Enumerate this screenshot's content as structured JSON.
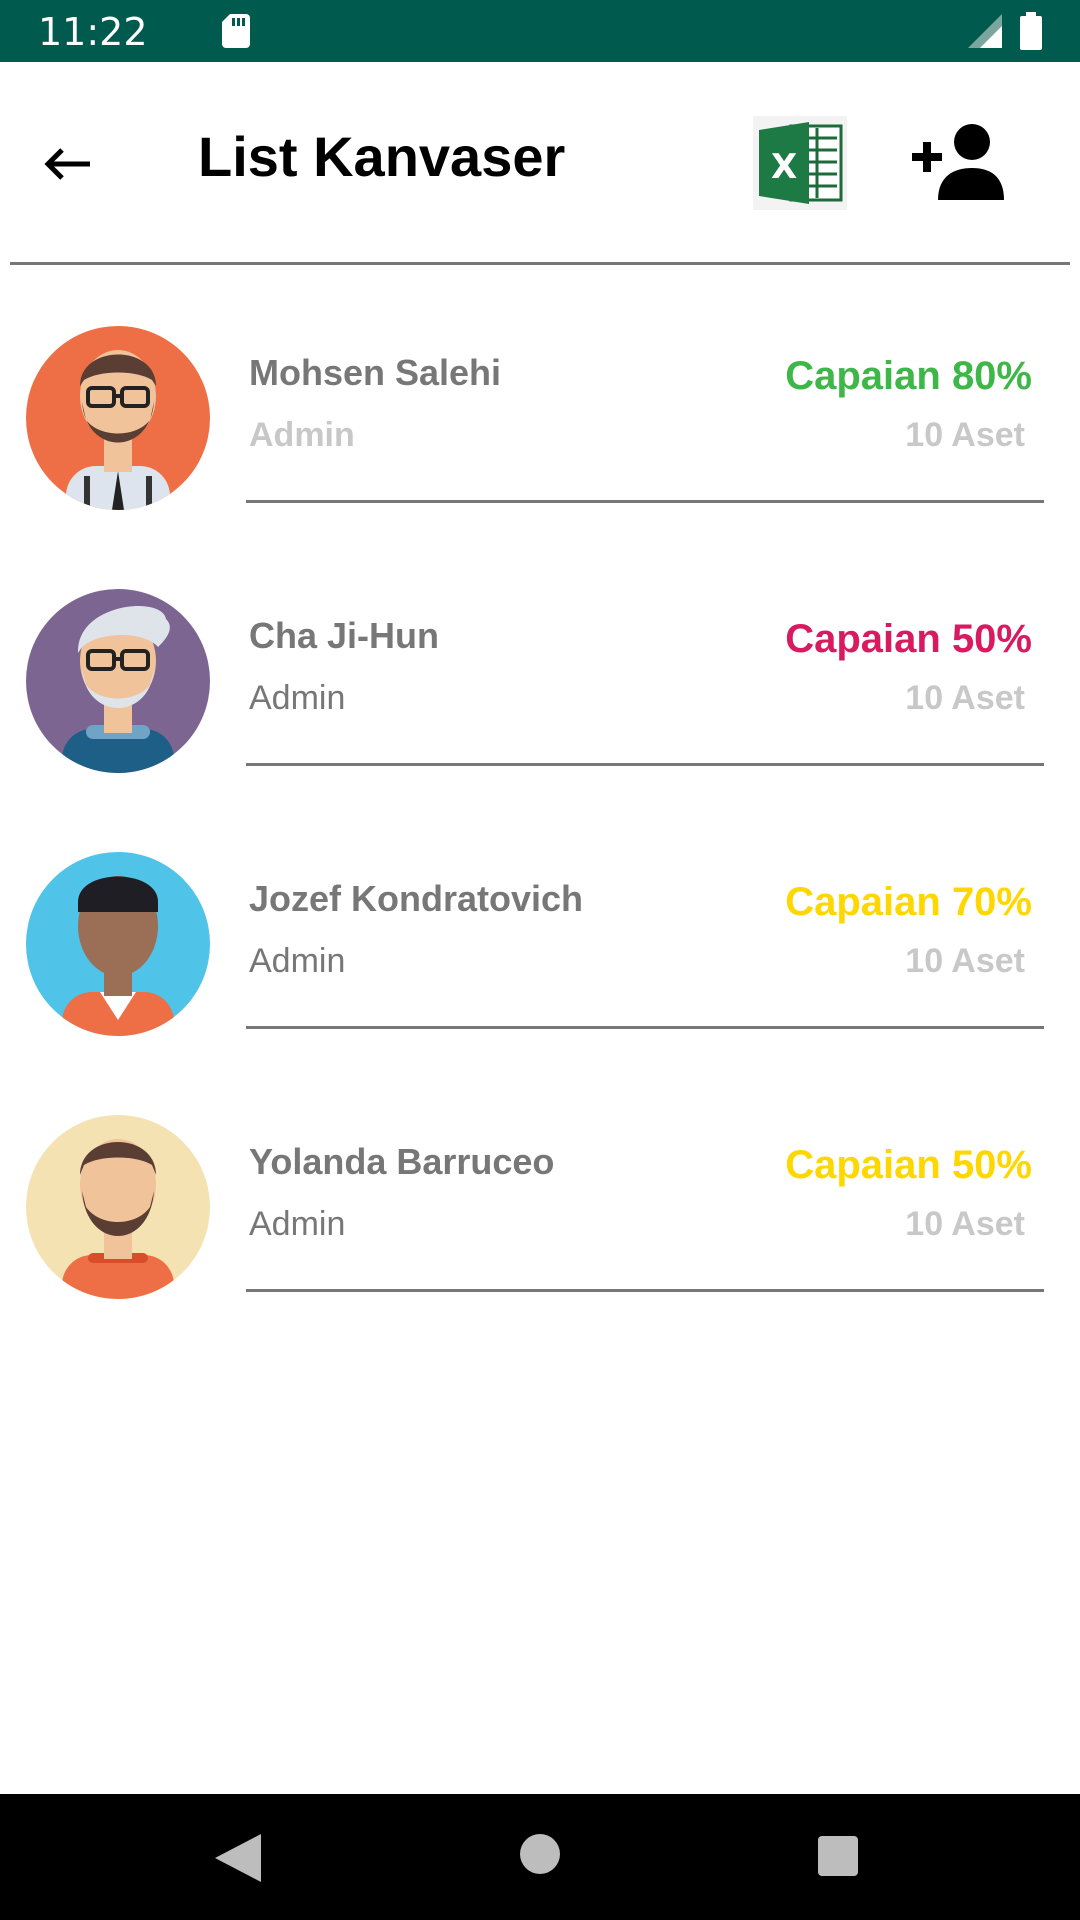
{
  "status_bar": {
    "time": "11:22"
  },
  "header": {
    "title": "List Kanvaser",
    "back_icon": "arrow-left-icon",
    "excel_icon": "excel-icon",
    "add_user_icon": "person-add-icon"
  },
  "colors": {
    "status_bar": "#005a4d",
    "green": "#3fb648",
    "red": "#d81b60",
    "yellow": "#ffd700"
  },
  "canvassers": [
    {
      "name": "Mohsen Salehi",
      "role": "Admin",
      "capaian": "Capaian 80%",
      "assets": "10 Aset",
      "capaian_color": "#3fb648",
      "avatar_bg": "#ee6f45"
    },
    {
      "name": "Cha Ji-Hun",
      "role": "Admin",
      "capaian": "Capaian 50%",
      "assets": "10 Aset",
      "capaian_color": "#d81b60",
      "avatar_bg": "#7d6592"
    },
    {
      "name": "Jozef Kondratovich",
      "role": "Admin",
      "capaian": "Capaian 70%",
      "assets": "10 Aset",
      "capaian_color": "#ffd700",
      "avatar_bg": "#4fc3e8"
    },
    {
      "name": "Yolanda Barruceo",
      "role": "Admin",
      "capaian": "Capaian 50%",
      "assets": "10 Aset",
      "capaian_color": "#ffd700",
      "avatar_bg": "#f5e2b3"
    }
  ]
}
